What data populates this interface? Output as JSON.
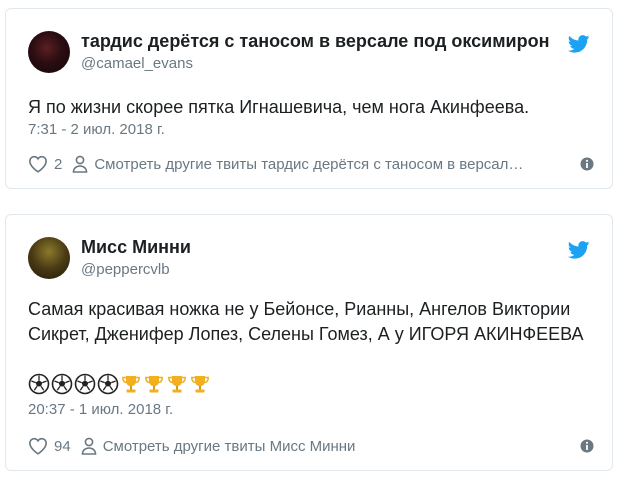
{
  "tweets": [
    {
      "name": "тардис дерётся с таносом в версале под оксимирон",
      "handle": "@camael_evans",
      "text": "Я по жизни скорее пятка Игнашевича, чем нога Акинфеева.",
      "date": "7:31 - 2 июл. 2018 г.",
      "likes": "2",
      "more_link": "Смотреть другие твиты тардис дерётся с таносом в версал…"
    },
    {
      "name": "Мисс Минни",
      "handle": "@peppercvlb",
      "text": "Самая красивая ножка не у Бейонсе, Рианны, Ангелов Виктории Сикрет, Дженифер Лопез, Селены Гомез, А у ИГОРЯ АКИНФЕЕВА",
      "emojis": [
        "soccer-ball-icon",
        "soccer-ball-icon",
        "soccer-ball-icon",
        "soccer-ball-icon",
        "trophy-icon",
        "trophy-icon",
        "trophy-icon",
        "trophy-icon"
      ],
      "date": "20:37 - 1 июл. 2018 г.",
      "likes": "94",
      "more_link": "Смотреть другие твиты Мисс Минни"
    }
  ],
  "colors": {
    "twitter_blue": "#1da1f2",
    "muted": "#697882",
    "text": "#1c2022",
    "border": "#e1e8ed"
  }
}
